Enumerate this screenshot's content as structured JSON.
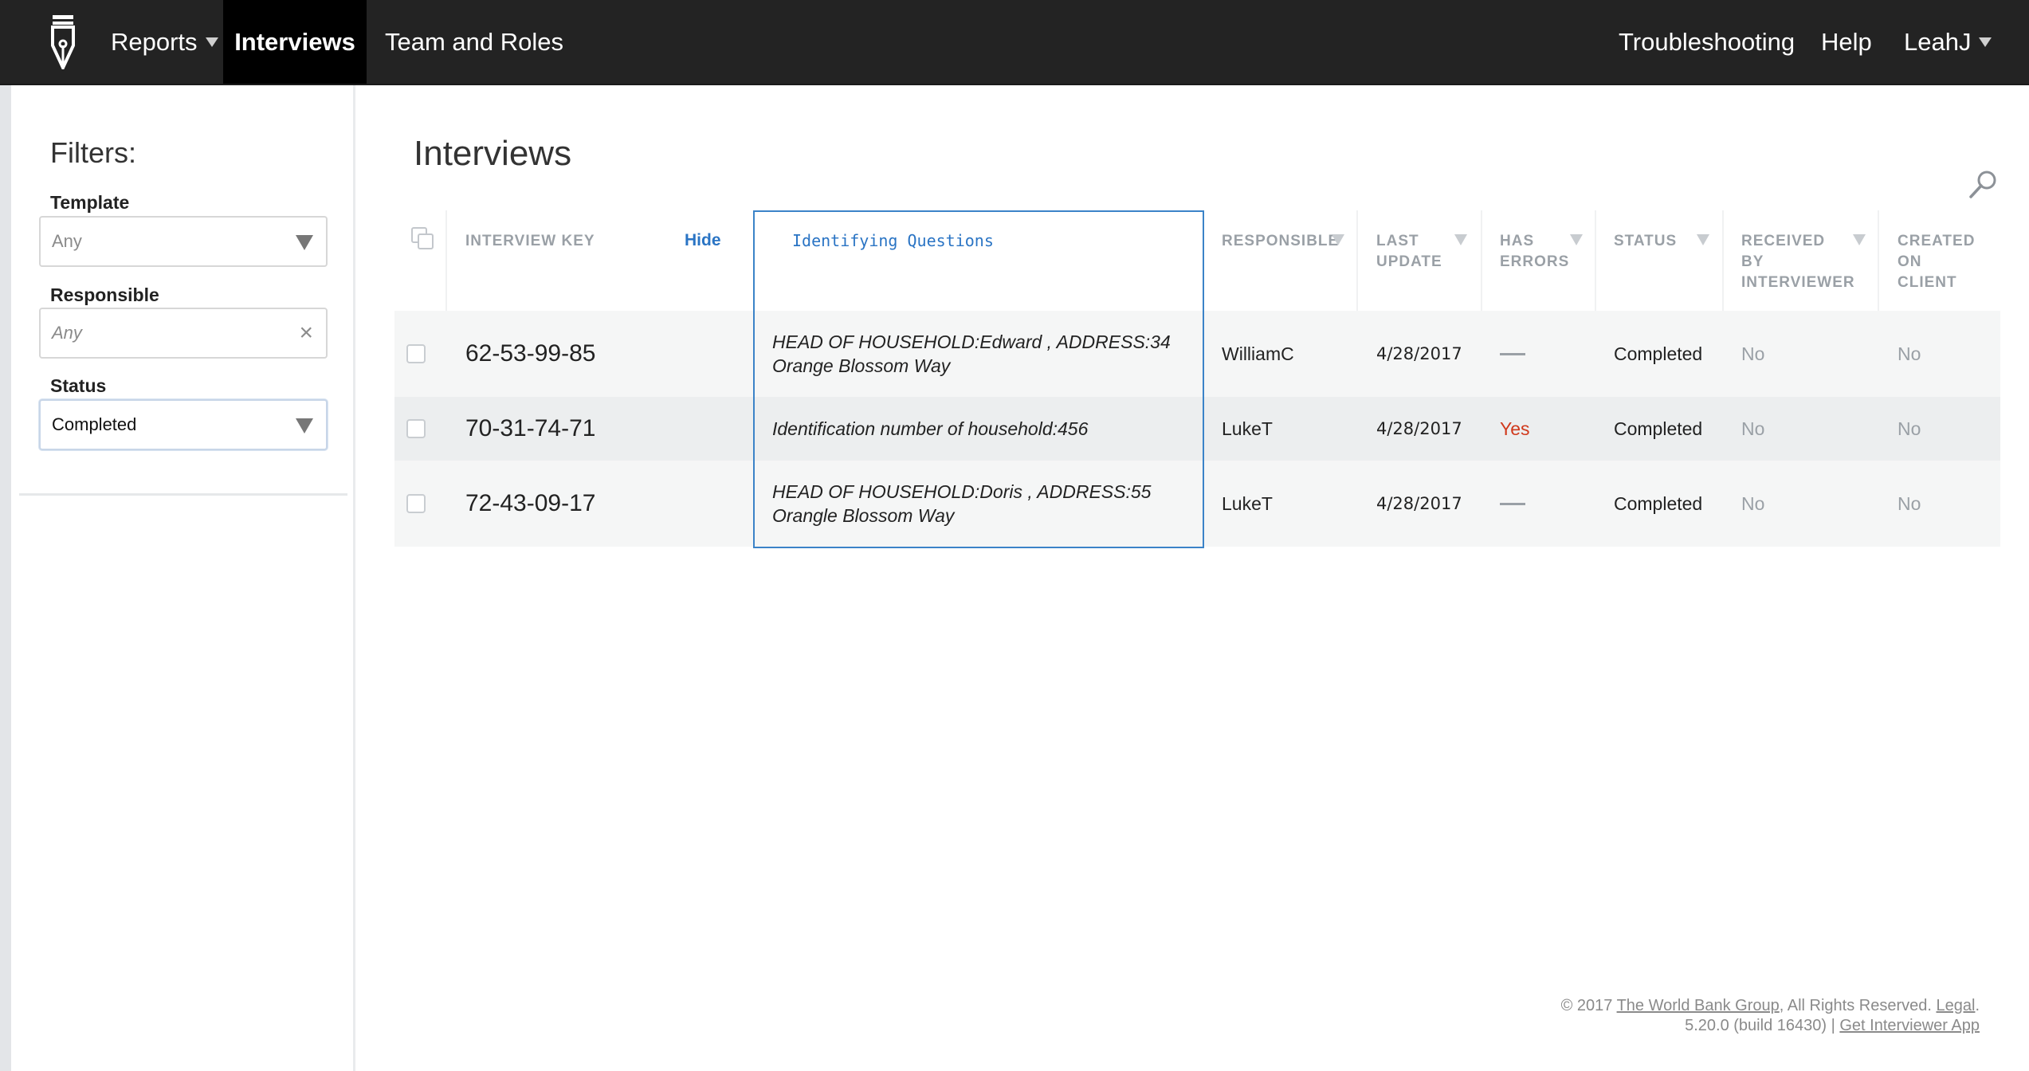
{
  "nav": {
    "logo_icon": "pen-nib-logo-icon",
    "reports": "Reports",
    "interviews": "Interviews",
    "team_and_roles": "Team and Roles",
    "troubleshooting": "Troubleshooting",
    "help": "Help",
    "user": "LeahJ"
  },
  "sidebar": {
    "title": "Filters:",
    "template": {
      "label": "Template",
      "value": "Any"
    },
    "responsible": {
      "label": "Responsible",
      "placeholder": "Any"
    },
    "status": {
      "label": "Status",
      "value": "Completed"
    }
  },
  "main": {
    "title": "Interviews",
    "search_icon": "search-icon"
  },
  "table": {
    "columns": {
      "interview_key": "Interview key",
      "hide": "Hide",
      "identifying_questions": "Identifying Questions",
      "responsible": "Responsible",
      "last_update": "Last update",
      "has_errors": "Has errors",
      "status": "Status",
      "received_by_interviewer": "Received by interviewer",
      "created_on_client": "Created on client"
    },
    "rows": [
      {
        "interview_key": "62-53-99-85",
        "identifying": "HEAD OF HOUSEHOLD:Edward , ADDRESS:34 Orange Blossom Way",
        "responsible": "WilliamC",
        "last_update": "4/28/2017",
        "has_errors": "—",
        "status": "Completed",
        "received": "No",
        "created_on_client": "No"
      },
      {
        "interview_key": "70-31-74-71",
        "identifying": "Identification number of household:456",
        "responsible": "LukeT",
        "last_update": "4/28/2017",
        "has_errors": "Yes",
        "status": "Completed",
        "received": "No",
        "created_on_client": "No"
      },
      {
        "interview_key": "72-43-09-17",
        "identifying": "HEAD OF HOUSEHOLD:Doris , ADDRESS:55 Orangle Blossom Way",
        "responsible": "LukeT",
        "last_update": "4/28/2017",
        "has_errors": "—",
        "status": "Completed",
        "received": "No",
        "created_on_client": "No"
      }
    ]
  },
  "footer": {
    "copyright": "© 2017",
    "org_link": "The World Bank Group",
    "rights": ", All Rights Reserved.",
    "legal_link": "Legal",
    "legal_suffix": ".",
    "version": "5.20.0 (build 16430) |",
    "app_link": "Get Interviewer App"
  },
  "colors": {
    "topbar": "#232323",
    "active_tab": "#000000",
    "accent_blue": "#2a74c4",
    "error_red": "#d0391c"
  }
}
